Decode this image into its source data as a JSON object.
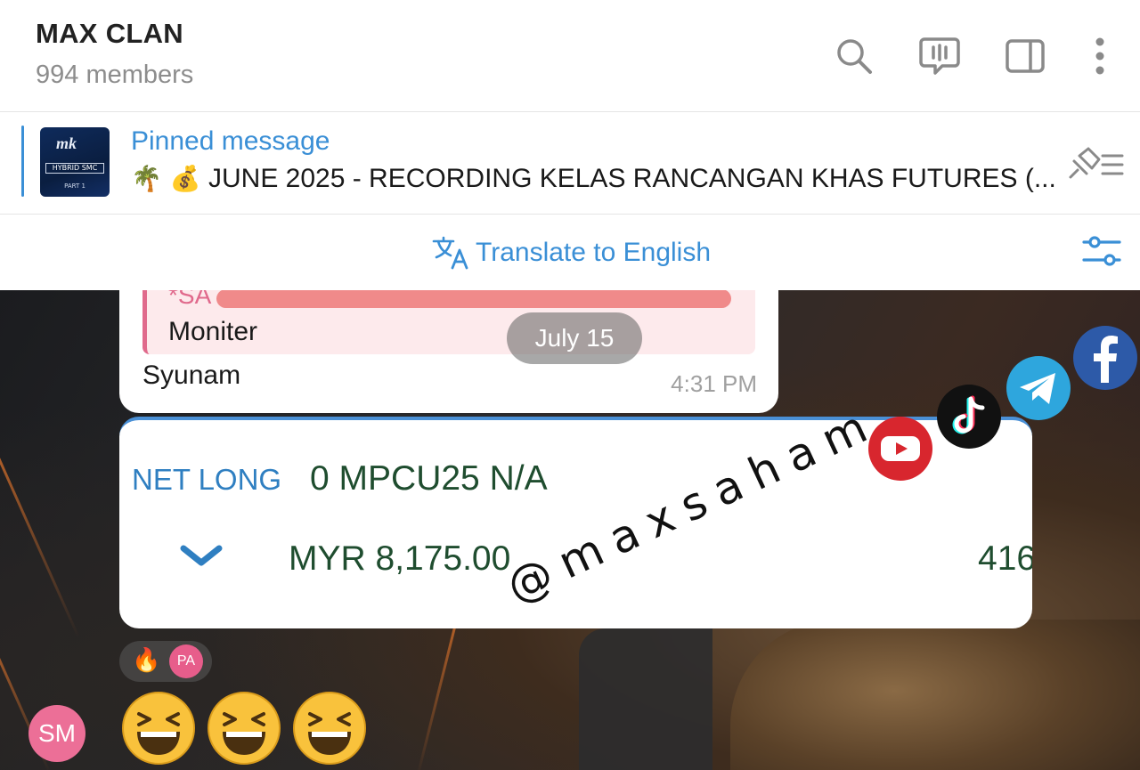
{
  "header": {
    "title": "MAX CLAN",
    "subtitle": "994 members",
    "icons": [
      "search-icon",
      "live-chat-icon",
      "sidebar-icon",
      "more-icon"
    ]
  },
  "pinned": {
    "title": "Pinned message",
    "thumb_logo": "mk",
    "thumb_badge": "HYBRID SMC",
    "thumb_caption": "PART 1",
    "emoji": "🌴 💰",
    "text": "JUNE 2025 - RECORDING KELAS RANCANGAN KHAS FUTURES (...",
    "accent": "#3a8fd6"
  },
  "translate": {
    "label": "Translate to English",
    "icon": "translate-icon",
    "settings_icon": "settings-sliders-icon"
  },
  "chat": {
    "date_pill": "July 15",
    "message": {
      "quote_author": "*SA",
      "quote_text": "Moniter",
      "text": "Syunam",
      "time": "4:31 PM"
    },
    "image": {
      "position_tag": "NET LONG",
      "position_main": "0 MPCU25 N/A",
      "price": "MYR 8,175.00",
      "qty": "416"
    },
    "watermark": "@maxsaham",
    "social_icons": [
      "youtube-icon",
      "tiktok-icon",
      "telegram-icon",
      "facebook-icon"
    ],
    "reactions": {
      "emoji": "🔥",
      "avatar": "PA"
    },
    "sender_avatar": "SM",
    "big_emojis": [
      "laughing-emoji",
      "laughing-emoji",
      "laughing-emoji"
    ]
  }
}
